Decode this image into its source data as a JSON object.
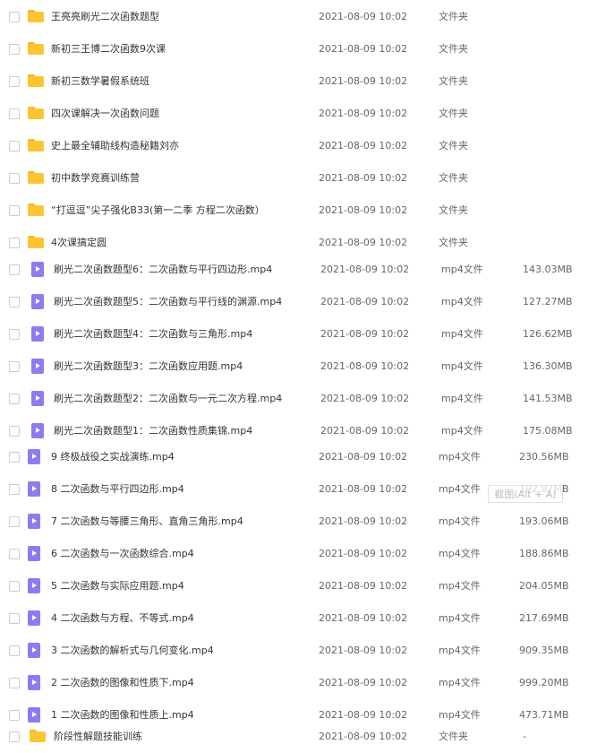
{
  "colors": {
    "folder": "#fbc531",
    "video": "#8c7cf0"
  },
  "rows": [
    {
      "icon": "folder-icon",
      "name": "王亮亮刷光二次函数题型",
      "date": "2021-08-09 10:02",
      "type": "文件夹",
      "size": ""
    },
    {
      "icon": "folder-icon",
      "name": "新初三王博二次函数9次课",
      "date": "2021-08-09 10:02",
      "type": "文件夹",
      "size": ""
    },
    {
      "icon": "folder-icon",
      "name": "新初三数学暑假系统班",
      "date": "2021-08-09 10:02",
      "type": "文件夹",
      "size": ""
    },
    {
      "icon": "folder-icon",
      "name": "四次课解决一次函数问题",
      "date": "2021-08-09 10:02",
      "type": "文件夹",
      "size": ""
    },
    {
      "icon": "folder-icon",
      "name": "史上最全辅助线构造秘籍刘亦",
      "date": "2021-08-09 10:02",
      "type": "文件夹",
      "size": ""
    },
    {
      "icon": "folder-icon",
      "name": "初中数学竞赛训练营",
      "date": "2021-08-09 10:02",
      "type": "文件夹",
      "size": ""
    },
    {
      "icon": "folder-icon",
      "name": "“打逗逗”尖子强化B33(第一二季 方程二次函数）",
      "date": "2021-08-09 10:02",
      "type": "文件夹",
      "size": ""
    },
    {
      "icon": "folder-icon",
      "name": "4次课搞定圆",
      "date": "2021-08-09 10:02",
      "type": "文件夹",
      "size": ""
    },
    {
      "icon": "video-file-icon",
      "name": "刷光二次函数题型6：二次函数与平行四边形.mp4",
      "date": "2021-08-09 10:02",
      "type": "mp4文件",
      "size": "143.03MB"
    },
    {
      "icon": "video-file-icon",
      "name": "刷光二次函数题型5：二次函数与平行线的渊源.mp4",
      "date": "2021-08-09 10:02",
      "type": "mp4文件",
      "size": "127.27MB"
    },
    {
      "icon": "video-file-icon",
      "name": "刷光二次函数题型4：二次函数与三角形.mp4",
      "date": "2021-08-09 10:02",
      "type": "mp4文件",
      "size": "126.62MB"
    },
    {
      "icon": "video-file-icon",
      "name": "刷光二次函数题型3：二次函数应用题.mp4",
      "date": "2021-08-09 10:02",
      "type": "mp4文件",
      "size": "136.30MB"
    },
    {
      "icon": "video-file-icon",
      "name": "刷光二次函数题型2：二次函数与一元二次方程.mp4",
      "date": "2021-08-09 10:02",
      "type": "mp4文件",
      "size": "141.53MB"
    },
    {
      "icon": "video-file-icon",
      "name": "刷光二次函数题型1：二次函数性质集锦.mp4",
      "date": "2021-08-09 10:02",
      "type": "mp4文件",
      "size": "175.08MB"
    },
    {
      "icon": "video-file-icon",
      "name": "9 终极战役之实战演练.mp4",
      "date": "2021-08-09 10:02",
      "type": "mp4文件",
      "size": "230.56MB"
    },
    {
      "icon": "video-file-icon",
      "name": "8 二次函数与平行四边形.mp4",
      "date": "2021-08-09 10:02",
      "type": "mp4文件",
      "size": "192.87MB"
    },
    {
      "icon": "video-file-icon",
      "name": "7 二次函数与等腰三角形、直角三角形.mp4",
      "date": "2021-08-09 10:02",
      "type": "mp4文件",
      "size": "193.06MB"
    },
    {
      "icon": "video-file-icon",
      "name": "6 二次函数与一次函数综合.mp4",
      "date": "2021-08-09 10:02",
      "type": "mp4文件",
      "size": "188.86MB"
    },
    {
      "icon": "video-file-icon",
      "name": "5 二次函数与实际应用题.mp4",
      "date": "2021-08-09 10:02",
      "type": "mp4文件",
      "size": "204.05MB"
    },
    {
      "icon": "video-file-icon",
      "name": "4 二次函数与方程、不等式.mp4",
      "date": "2021-08-09 10:02",
      "type": "mp4文件",
      "size": "217.69MB"
    },
    {
      "icon": "video-file-icon",
      "name": "3 二次函数的解析式与几何变化.mp4",
      "date": "2021-08-09 10:02",
      "type": "mp4文件",
      "size": "909.35MB"
    },
    {
      "icon": "video-file-icon",
      "name": "2 二次函数的图像和性质下.mp4",
      "date": "2021-08-09 10:02",
      "type": "mp4文件",
      "size": "999.20MB"
    },
    {
      "icon": "video-file-icon",
      "name": "1 二次函数的图像和性质上.mp4",
      "date": "2021-08-09 10:02",
      "type": "mp4文件",
      "size": "473.71MB"
    },
    {
      "icon": "folder-icon",
      "name": "阶段性解题技能训练",
      "date": "2021-08-09 10:02",
      "type": "文件夹",
      "size": "-"
    }
  ],
  "tooltip": {
    "text": "截图(Alt + A)"
  }
}
